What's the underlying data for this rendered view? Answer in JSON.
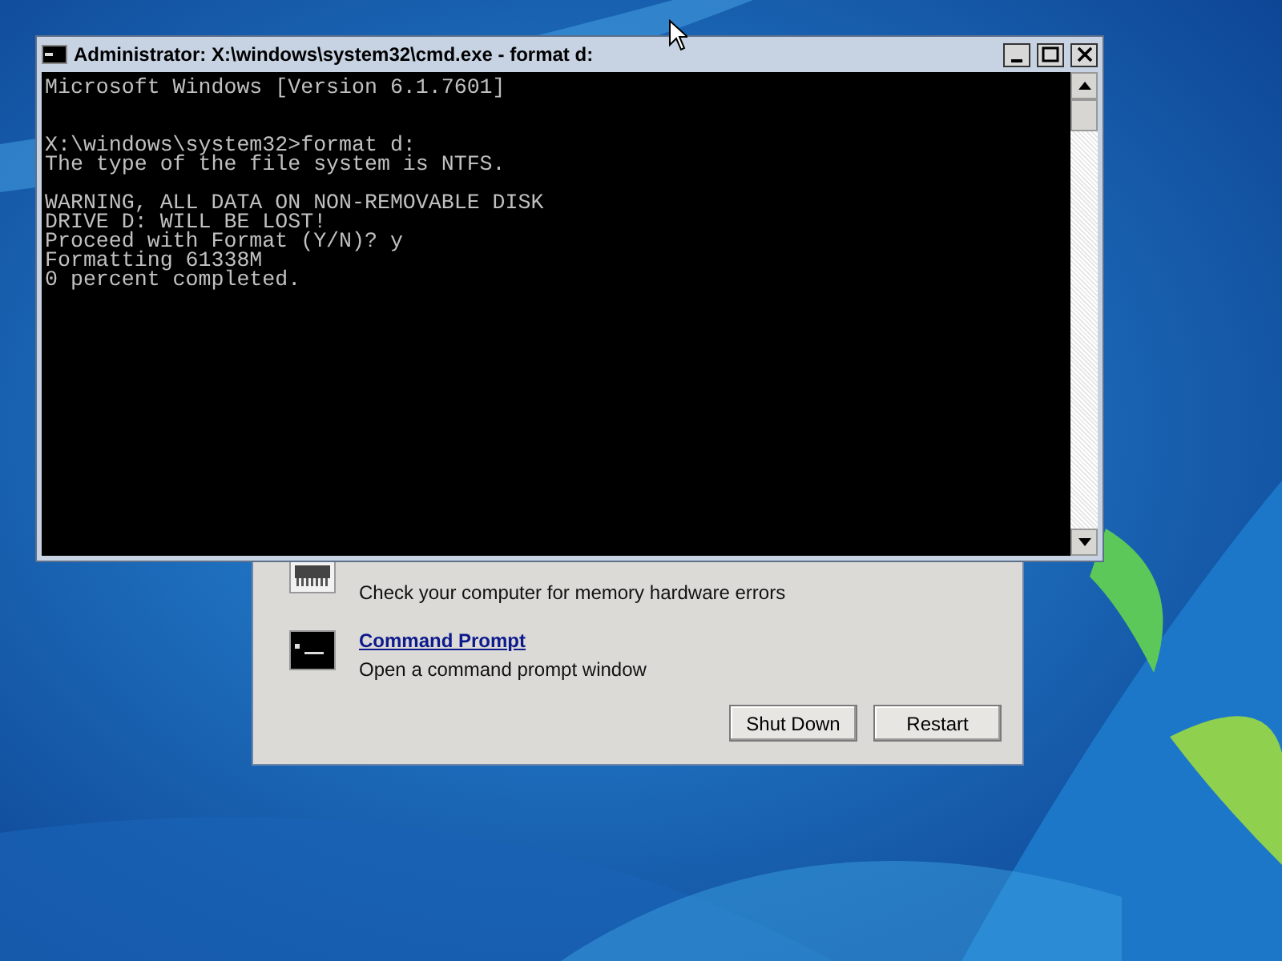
{
  "console_window": {
    "title": "Administrator: X:\\windows\\system32\\cmd.exe - format  d:",
    "lines": [
      {
        "kind": "text",
        "text": "Microsoft Windows [Version 6.1.7601]"
      },
      {
        "kind": "blank"
      },
      {
        "kind": "blank"
      },
      {
        "kind": "text",
        "text": "X:\\windows\\system32>format d:"
      },
      {
        "kind": "text",
        "text": "The type of the file system is NTFS."
      },
      {
        "kind": "blank"
      },
      {
        "kind": "text",
        "text": "WARNING, ALL DATA ON NON-REMOVABLE DISK"
      },
      {
        "kind": "text",
        "text": "DRIVE D: WILL BE LOST!"
      },
      {
        "kind": "text",
        "text": "Proceed with Format (Y/N)? y"
      },
      {
        "kind": "text",
        "text": "Formatting 61338M"
      },
      {
        "kind": "text",
        "text": "0 percent completed."
      }
    ]
  },
  "recovery_dialog": {
    "tools": [
      {
        "kind": "memory",
        "description": "Check your computer for memory hardware errors"
      },
      {
        "kind": "prompt",
        "link": "Command Prompt",
        "description": "Open a command prompt window"
      }
    ],
    "buttons": [
      "Shut Down",
      "Restart"
    ]
  }
}
